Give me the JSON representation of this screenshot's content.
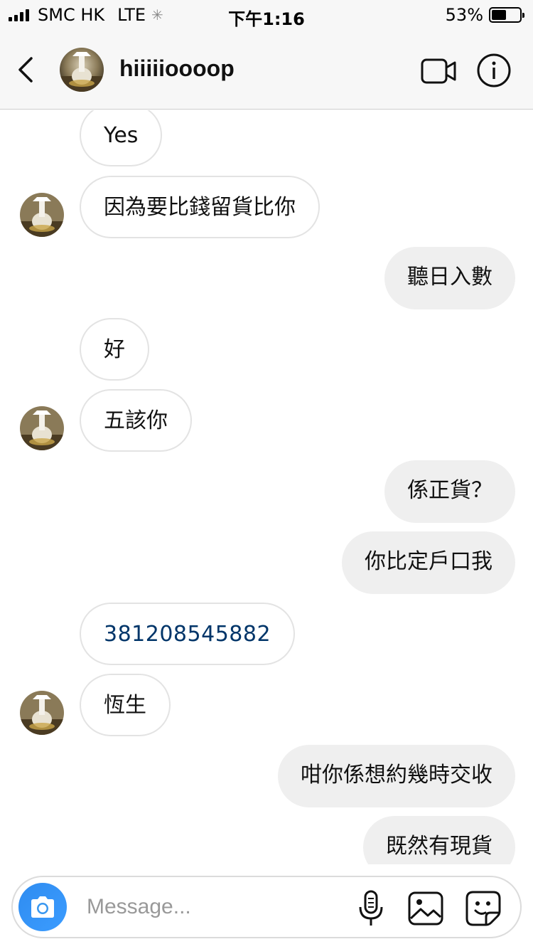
{
  "status_bar": {
    "carrier": "SMC HK",
    "network": "LTE",
    "time": "下午1:16",
    "battery_percent": "53%",
    "battery_level": 0.53
  },
  "header": {
    "username": "hiiiiioooop"
  },
  "messages": [
    {
      "direction": "incoming",
      "text": "Yes",
      "avatar": false
    },
    {
      "direction": "incoming",
      "text": "因為要比錢留貨比你",
      "avatar": true
    },
    {
      "direction": "outgoing",
      "text": "聽日入數"
    },
    {
      "direction": "incoming",
      "text": "好",
      "avatar": false
    },
    {
      "direction": "incoming",
      "text": "五該你",
      "avatar": true
    },
    {
      "direction": "outgoing",
      "text": "係正貨？"
    },
    {
      "direction": "outgoing",
      "text": "你比定戶口我"
    },
    {
      "direction": "incoming",
      "text": "381208545882",
      "avatar": false,
      "is_link": true
    },
    {
      "direction": "incoming",
      "text": "恆生",
      "avatar": true
    },
    {
      "direction": "outgoing",
      "text": "咁你係想約幾時交收"
    },
    {
      "direction": "outgoing",
      "text": "既然有現貨"
    }
  ],
  "composer": {
    "placeholder": "Message..."
  },
  "icons": {
    "back": "chevron-left-icon",
    "video": "video-camera-icon",
    "info": "info-icon",
    "camera": "camera-icon",
    "mic": "microphone-icon",
    "gallery": "image-icon",
    "sticker": "sticker-icon"
  },
  "colors": {
    "accent_blue": "#3897f0",
    "link_text": "#003569",
    "outgoing_bubble": "#efefef",
    "incoming_border": "#e3e3e3"
  }
}
